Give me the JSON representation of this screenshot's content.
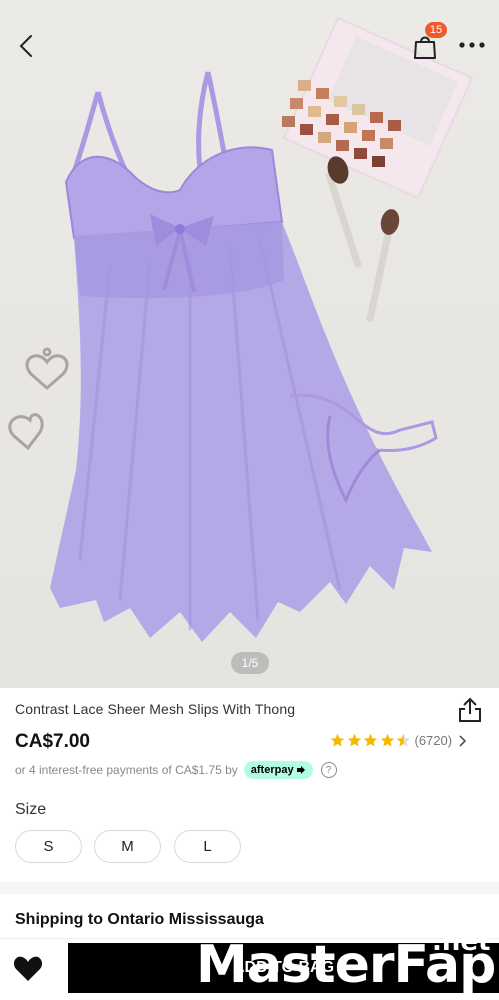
{
  "header": {
    "bag_count": "15"
  },
  "gallery": {
    "pager": "1/5"
  },
  "product": {
    "title": "Contrast Lace Sheer Mesh Slips With Thong",
    "price": "CA$7.00",
    "rating_value": 4.5,
    "rating_count": "(6720)",
    "installments_text": "or 4 interest-free payments of CA$1.75 by",
    "afterpay_label": "afterpay",
    "help_symbol": "?"
  },
  "size": {
    "label": "Size",
    "options": [
      "S",
      "M",
      "L"
    ]
  },
  "shipping": {
    "title": "Shipping to Ontario Mississauga"
  },
  "actions": {
    "add_to_bag": "ADD TO BAG"
  },
  "watermark": {
    "main": "MasterFap",
    "suffix": ".net"
  },
  "colors": {
    "garment": "#a99ae3",
    "star": "#f5b800",
    "afterpay": "#b2fce4",
    "badge": "#f15a2b"
  }
}
